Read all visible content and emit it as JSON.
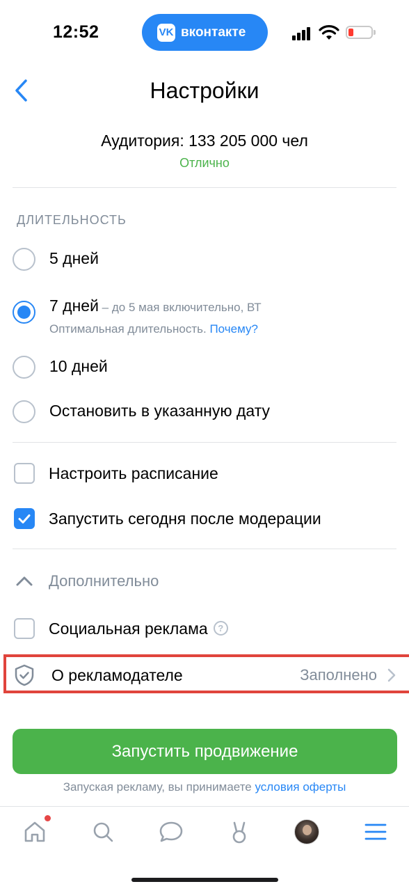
{
  "status_bar": {
    "time": "12:52",
    "app_pill": {
      "label": "вконтакте",
      "logo": "VK",
      "color": "#2787f5"
    },
    "battery_color": "#ff3b30"
  },
  "header": {
    "back_icon": "chevron-left-icon",
    "title": "Настройки"
  },
  "audience": {
    "text": "Аудитория: 133 205 000 чел",
    "status": "Отлично",
    "status_color": "#4bb34b"
  },
  "duration": {
    "header": "ДЛИТЕЛЬНОСТЬ",
    "options": [
      {
        "label": "5 дней",
        "selected": false
      },
      {
        "label": "7 дней",
        "suffix": " – до 5 мая включительно, ВТ",
        "description": "Оптимальная длительность.",
        "link": "Почему?",
        "selected": true
      },
      {
        "label": "10 дней",
        "selected": false
      },
      {
        "label": "Остановить в указанную дату",
        "selected": false
      }
    ]
  },
  "schedule": {
    "options": [
      {
        "label": "Настроить расписание",
        "checked": false
      },
      {
        "label": "Запустить сегодня после модерации",
        "checked": true
      }
    ]
  },
  "extra": {
    "label": "Дополнительно",
    "expanded": true,
    "social_ad": {
      "label": "Социальная реклама",
      "checked": false,
      "help_icon": "question-circle-icon"
    },
    "advertiser": {
      "label": "О рекламодателе",
      "value": "Заполнено",
      "icon": "shield-check-icon"
    }
  },
  "cta": {
    "label": "Запустить продвижение",
    "color": "#4bb34b"
  },
  "terms": {
    "text": "Запуская рекламу, вы принимаете",
    "link": "условия оферты"
  },
  "tabbar": {
    "items": [
      "home-icon",
      "search-icon",
      "messages-icon",
      "clips-icon",
      "profile-avatar",
      "menu-icon"
    ],
    "home_badge": true
  },
  "accent_color": "#2787f5"
}
